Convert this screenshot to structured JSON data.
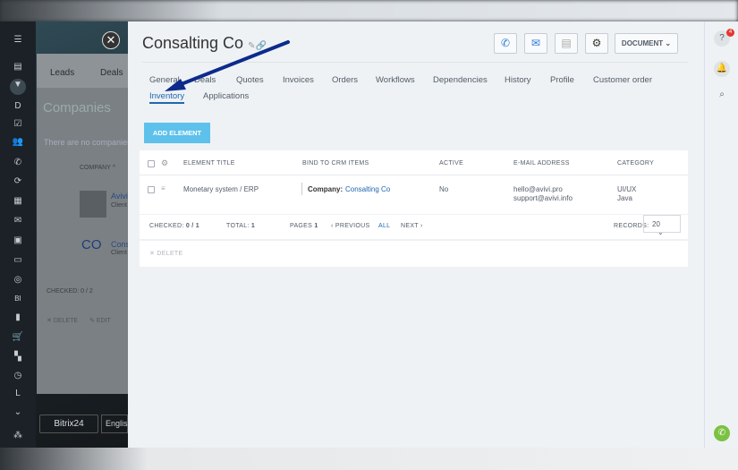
{
  "background": {
    "tabs": [
      "Leads",
      "Deals"
    ],
    "page_title": "Companies",
    "empty_msg": "There are no companies",
    "column": "COMPANY ^",
    "rows": [
      {
        "name": "Avivi",
        "type": "Client"
      },
      {
        "name": "Cons",
        "type": "Client",
        "logo": "CO"
      }
    ],
    "checked": "CHECKED: 0 / 2",
    "actions": [
      "DELETE",
      "EDIT"
    ],
    "brand": "Bitrix24",
    "language": "Englis",
    "nav_letters": [
      "D",
      "BI",
      "L"
    ],
    "badge": "4"
  },
  "header": {
    "title": "Consalting Co",
    "document_label": "DOCUMENT"
  },
  "tabs": [
    {
      "label": "General"
    },
    {
      "label": "Deals"
    },
    {
      "label": "Quotes"
    },
    {
      "label": "Invoices"
    },
    {
      "label": "Orders"
    },
    {
      "label": "Workflows"
    },
    {
      "label": "Dependencies"
    },
    {
      "label": "History"
    },
    {
      "label": "Profile"
    },
    {
      "label": "Customer order"
    },
    {
      "label": "Inventory",
      "active": true
    },
    {
      "label": "Applications"
    }
  ],
  "add_button": "ADD ELEMENT",
  "table": {
    "columns": [
      "ELEMENT TITLE",
      "BIND TO CRM ITEMS",
      "ACTIVE",
      "E-MAIL ADDRESS",
      "CATEGORY"
    ],
    "rows": [
      {
        "title": "Monetary system / ERP",
        "bind_label": "Company:",
        "bind_value": "Consalting Co",
        "active": "No",
        "emails": [
          "hello@avivi.pro",
          "support@avivi.info"
        ],
        "categories": [
          "UI/UX",
          "Java"
        ]
      }
    ]
  },
  "footer": {
    "checked_label": "CHECKED:",
    "checked": "0 / 1",
    "total_label": "TOTAL:",
    "total": "1",
    "pages_label": "PAGES",
    "pages": "1",
    "previous": "PREVIOUS",
    "all": "ALL",
    "next": "NEXT",
    "records_label": "RECORDS:",
    "records": "20"
  },
  "delete_label": "DELETE",
  "right_panel": {
    "help_badge": "4"
  },
  "colors": {
    "accent": "#2067b0",
    "add_button": "#5ec1ec",
    "arrow": "#0d2a8c",
    "badge": "#e5362f",
    "call": "#7bc142"
  }
}
